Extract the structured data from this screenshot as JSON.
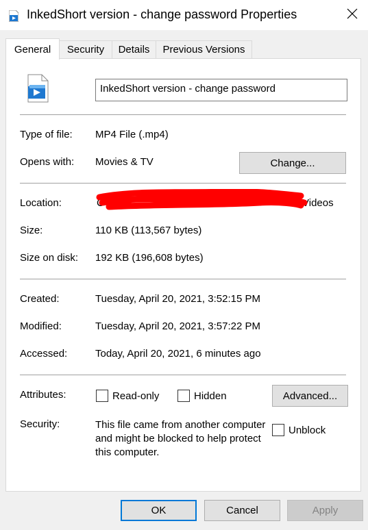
{
  "window": {
    "title": "InkedShort version - change password Properties",
    "close_icon": "close-icon"
  },
  "tabs": [
    {
      "label": "General",
      "active": true
    },
    {
      "label": "Security",
      "active": false
    },
    {
      "label": "Details",
      "active": false
    },
    {
      "label": "Versions",
      "active": false,
      "full": "Previous Versions"
    }
  ],
  "general": {
    "filename": "InkedShort version - change password",
    "type_of_file_label": "Type of file:",
    "type_of_file": "MP4 File (.mp4)",
    "opens_with_label": "Opens with:",
    "opens_with": "Movies & TV",
    "change_button": "Change...",
    "location_label": "Location:",
    "location_visible_fragment": "Videos",
    "location_leading_char": "C",
    "size_label": "Size:",
    "size": "110 KB (113,567 bytes)",
    "size_on_disk_label": "Size on disk:",
    "size_on_disk": "192 KB (196,608 bytes)",
    "created_label": "Created:",
    "created": "Tuesday, April 20, 2021, 3:52:15 PM",
    "modified_label": "Modified:",
    "modified": "Tuesday, April 20, 2021, 3:57:22 PM",
    "accessed_label": "Accessed:",
    "accessed": "Today, April 20, 2021, 6 minutes ago",
    "attributes_label": "Attributes:",
    "readonly_label": "Read-only",
    "hidden_label": "Hidden",
    "advanced_button": "Advanced...",
    "security_label": "Security:",
    "security_text": "This file came from another computer and might be blocked to help protect this computer.",
    "unblock_label": "Unblock"
  },
  "footer": {
    "ok": "OK",
    "cancel": "Cancel",
    "apply": "Apply"
  },
  "colors": {
    "accent": "#0078d7",
    "redaction": "#ff0000"
  }
}
